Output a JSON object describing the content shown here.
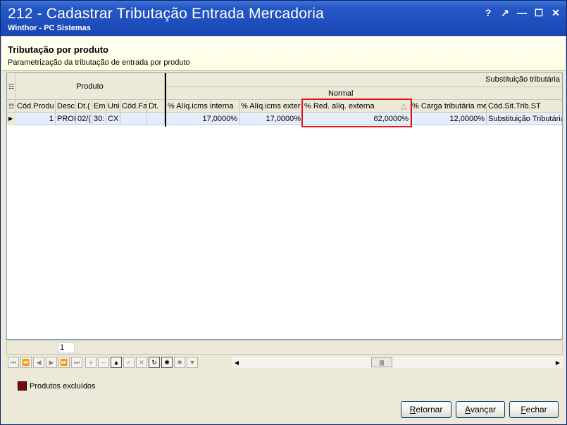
{
  "window": {
    "title": "212 - Cadastrar Tributação Entrada Mercadoria",
    "subtitle": "Winthor - PC Sistemas",
    "controls": [
      "?",
      "↗",
      "—",
      "☐",
      "✕"
    ]
  },
  "header": {
    "title": "Tributação por produto",
    "subtitle": "Parametrização da tributação de entrada por produto"
  },
  "grid": {
    "band_produto": "Produto",
    "band_subst": "Substituição tributária",
    "band_normal": "Normal",
    "columns": [
      "Cód.Produ",
      "Desc",
      "Dt.(",
      "Em",
      "Uni",
      "Cód.Fa",
      "Dt.",
      "% Alíq.icms interna",
      "% Alíq.icms exter",
      "% Red. alíq. externa",
      "% Carga tributária me",
      "Cód.Sit.Trib.ST"
    ],
    "sort_glyph": "△",
    "row": [
      "1",
      "PROI",
      "02/(",
      "30:",
      "CX",
      "",
      "",
      "17,0000%",
      "17,0000%",
      "62,0000%",
      "12,0000%",
      "Substituição Tributária"
    ]
  },
  "footer": {
    "page": "1",
    "legend": "Produtos excluídos",
    "legend_color": "#7a0a0a",
    "buttons": {
      "retornar_pre": "R",
      "retornar_rest": "etornar",
      "avancar_pre": "A",
      "avancar_rest": "vançar",
      "fechar_pre": "F",
      "fechar_rest": "echar"
    }
  }
}
